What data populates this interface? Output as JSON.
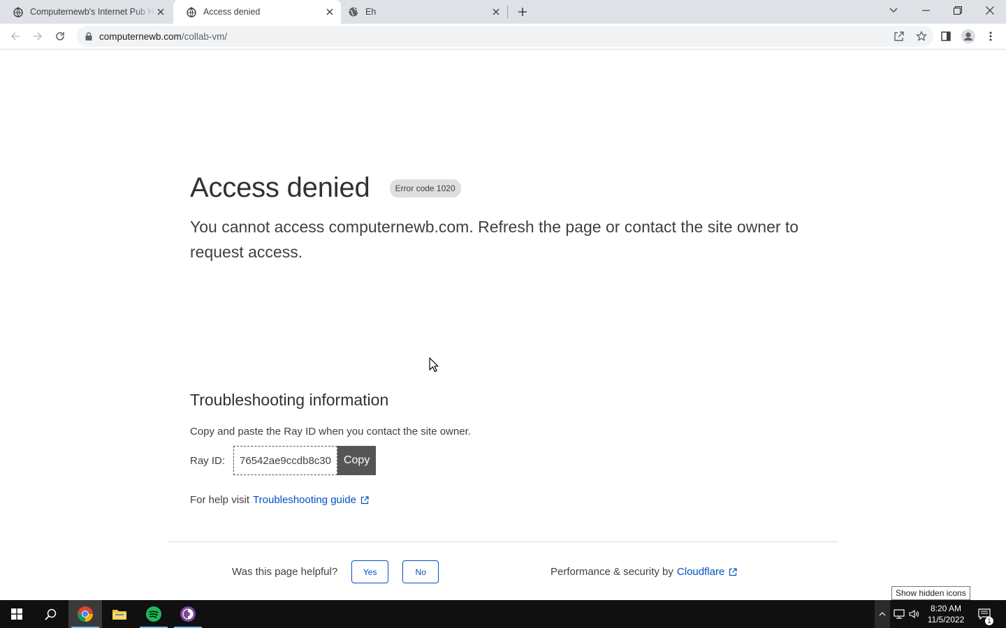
{
  "browser": {
    "tabs": [
      {
        "title": "Computernewb's Internet Pub H",
        "icon": "globe-hat-icon",
        "active": false
      },
      {
        "title": "Access denied",
        "icon": "globe-hat-icon",
        "active": true
      },
      {
        "title": "Eh",
        "icon": "globe-icon",
        "active": false
      }
    ],
    "url_domain": "computernewb.com",
    "url_path": "/collab-vm/"
  },
  "page": {
    "heading": "Access denied",
    "error_badge": "Error code 1020",
    "subtitle": "You cannot access computernewb.com. Refresh the page or contact the site owner to request access.",
    "troubleshooting_heading": "Troubleshooting information",
    "copy_instruction": "Copy and paste the Ray ID when you contact the site owner.",
    "ray_label": "Ray ID:",
    "ray_id": "76542ae9ccdb8c30",
    "copy_label": "Copy",
    "help_prefix": "For help visit",
    "help_link": "Troubleshooting guide",
    "helpful_question": "Was this page helpful?",
    "yes_label": "Yes",
    "no_label": "No",
    "perf_prefix": "Performance & security by",
    "cloudflare_link": "Cloudflare"
  },
  "taskbar": {
    "time": "8:20 AM",
    "date": "11/5/2022",
    "tooltip": "Show hidden icons",
    "notification_count": "1"
  },
  "colors": {
    "link": "#0051c3",
    "taskbar": "#101010",
    "tab_strip": "#dee1e6"
  }
}
